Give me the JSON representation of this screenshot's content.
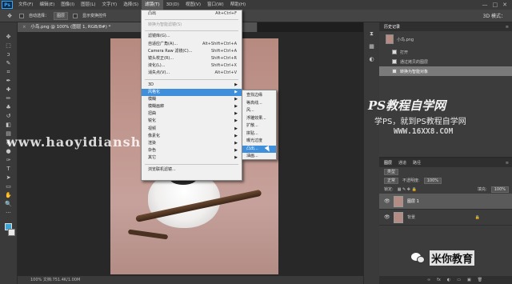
{
  "app": {
    "logo": "Ps"
  },
  "menubar": {
    "items": [
      "文件(F)",
      "编辑(E)",
      "图像(I)",
      "图层(L)",
      "文字(Y)",
      "选择(S)",
      "滤镜(T)",
      "3D(D)",
      "视图(V)",
      "窗口(W)",
      "帮助(H)"
    ],
    "window_controls": [
      "—",
      "□",
      "✕"
    ]
  },
  "options_bar": {
    "auto_select": "自动选择：",
    "layer_dropdown": "图层",
    "show_transform": "显示变换控件",
    "mode_3d": "3D 模式："
  },
  "document": {
    "tab_title": "小鸟.png @ 100% (图层 1, RGB/8#) *",
    "close": "×"
  },
  "status_bar": {
    "text": "100%    文档:751.4K/1.00M"
  },
  "watermarks": {
    "url": "www.haoyidianshi.com",
    "brand_title": "PS教程自学网",
    "brand_slogan": "学PS，就到PS教程自学网",
    "brand_url": "WWW.16XX8.COM",
    "wechat": "米你教育"
  },
  "filter_menu": {
    "items": [
      {
        "label": "凸出",
        "shortcut": "Alt+Ctrl+F",
        "state": "normal"
      },
      {
        "sep": true
      },
      {
        "label": "转换为智能滤镜(S)",
        "state": "disabled"
      },
      {
        "sep": true
      },
      {
        "label": "滤镜库(G)...",
        "state": "normal"
      },
      {
        "label": "自适应广角(A)...",
        "shortcut": "Alt+Shift+Ctrl+A",
        "state": "normal"
      },
      {
        "label": "Camera Raw 滤镜(C)...",
        "shortcut": "Shift+Ctrl+A",
        "state": "normal"
      },
      {
        "label": "镜头校正(R)...",
        "shortcut": "Shift+Ctrl+R",
        "state": "normal"
      },
      {
        "label": "液化(L)...",
        "shortcut": "Shift+Ctrl+X",
        "state": "normal"
      },
      {
        "label": "消失点(V)...",
        "shortcut": "Alt+Ctrl+V",
        "state": "normal"
      },
      {
        "sep": true
      },
      {
        "label": "3D",
        "submenu": true,
        "state": "normal"
      },
      {
        "label": "风格化",
        "submenu": true,
        "state": "highlight"
      },
      {
        "label": "模糊",
        "submenu": true,
        "state": "normal"
      },
      {
        "label": "模糊画廊",
        "submenu": true,
        "state": "normal"
      },
      {
        "label": "扭曲",
        "submenu": true,
        "state": "normal"
      },
      {
        "label": "锐化",
        "submenu": true,
        "state": "normal"
      },
      {
        "label": "视频",
        "submenu": true,
        "state": "normal"
      },
      {
        "label": "像素化",
        "submenu": true,
        "state": "normal"
      },
      {
        "label": "渲染",
        "submenu": true,
        "state": "normal"
      },
      {
        "label": "杂色",
        "submenu": true,
        "state": "normal"
      },
      {
        "label": "其它",
        "submenu": true,
        "state": "normal"
      },
      {
        "sep": true
      },
      {
        "label": "浏览联机滤镜...",
        "state": "normal"
      }
    ]
  },
  "stylize_submenu": {
    "items": [
      {
        "label": "查找边缘",
        "state": "normal"
      },
      {
        "label": "等高线...",
        "state": "normal"
      },
      {
        "label": "风...",
        "state": "normal"
      },
      {
        "label": "浮雕效果...",
        "state": "normal"
      },
      {
        "label": "扩散...",
        "state": "normal"
      },
      {
        "label": "拼贴...",
        "state": "normal"
      },
      {
        "label": "曝光过度",
        "state": "normal"
      },
      {
        "label": "凸出...",
        "state": "highlight"
      },
      {
        "label": "油画...",
        "state": "normal"
      }
    ]
  },
  "history_panel": {
    "tabs": [
      "历史记录"
    ],
    "snapshot": "小鸟.png",
    "steps": [
      {
        "label": "打开",
        "selected": false
      },
      {
        "label": "通过拷贝的图层",
        "selected": false
      },
      {
        "label": "转换为智能对象",
        "selected": true
      }
    ]
  },
  "layers_panel": {
    "tabs": [
      "图层",
      "通道",
      "路径"
    ],
    "kind_filter": "类型",
    "blend_mode": "正常",
    "opacity_label": "不透明度:",
    "opacity_value": "100%",
    "lock_label": "锁定:",
    "fill_label": "填充:",
    "fill_value": "100%",
    "layers": [
      {
        "name": "图层 1",
        "selected": true,
        "locked": false
      },
      {
        "name": "背景",
        "selected": false,
        "locked": true
      }
    ],
    "bottom_icons": [
      "∞",
      "fx",
      "◐",
      "▭",
      "▣",
      "🗑"
    ]
  },
  "colors": {
    "accent": "#3f8fdb",
    "foreground_swatch": "#3aa7d8",
    "background_swatch": "#e8e8e8"
  }
}
